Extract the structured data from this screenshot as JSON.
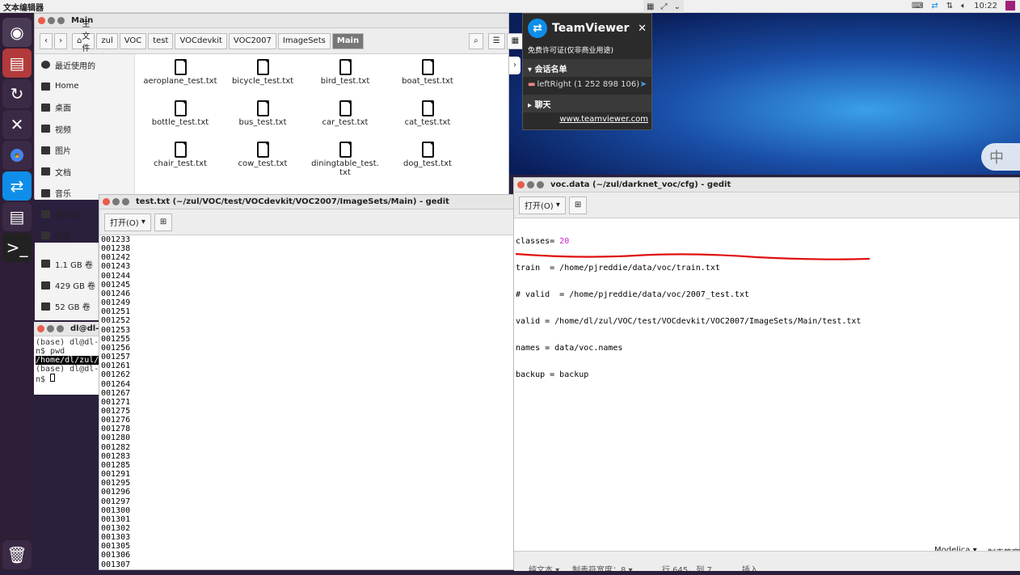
{
  "topbar": {
    "app_name": "文本编辑器",
    "time": "10:22"
  },
  "files_window": {
    "title": "Main",
    "path": [
      "主文件夹",
      "zul",
      "VOC",
      "test",
      "VOCdevkit",
      "VOC2007",
      "ImageSets",
      "Main"
    ],
    "sidebar": [
      "最近使用的",
      "Home",
      "桌面",
      "视频",
      "图片",
      "文档",
      "音乐",
      "回收站",
      "网络",
      "1.1 GB 卷",
      "429 GB 卷",
      "52 GB 卷"
    ],
    "files": [
      "aeroplane_test.txt",
      "bicycle_test.txt",
      "bird_test.txt",
      "boat_test.txt",
      "bottle_test.txt",
      "bus_test.txt",
      "car_test.txt",
      "cat_test.txt",
      "chair_test.txt",
      "cow_test.txt",
      "diningtable_test.\ntxt",
      "dog_test.txt"
    ]
  },
  "teamviewer": {
    "brand": "TeamViewer",
    "license": "免费许可证(仅非商业用途)",
    "sessions_label": "会话名单",
    "session_item": "leftRight (1 252 898 106)",
    "chat_label": "聊天",
    "link": "www.teamviewer.com"
  },
  "terminal": {
    "title": "dl@dl-",
    "lines": [
      "(base) dl@dl-",
      "n$ pwd",
      "/home/dl/zul/",
      "(base) dl@dl-",
      "n$ "
    ]
  },
  "gedit_test": {
    "title": "test.txt (~/zul/VOC/test/VOCdevkit/VOC2007/ImageSets/Main) - gedit",
    "open_label": "打开(O)",
    "lines": [
      "001233",
      "001238",
      "001242",
      "001243",
      "001244",
      "001245",
      "001246",
      "001249",
      "001251",
      "001252",
      "001253",
      "001255",
      "001256",
      "001257",
      "001261",
      "001262",
      "001264",
      "001267",
      "001271",
      "001275",
      "001276",
      "001278",
      "001280",
      "001282",
      "001283",
      "001285",
      "001291",
      "001295",
      "001296",
      "001297",
      "001300",
      "001301",
      "001302",
      "001303",
      "001305",
      "001306",
      "001307"
    ]
  },
  "gedit_voc": {
    "title": "voc.data (~/zul/darknet_voc/cfg) - gedit",
    "open_label": "打开(O)",
    "lines": [
      {
        "key": "classes= ",
        "value": "20"
      },
      {
        "key": "train  = /home/pjreddie/data/voc/train.txt",
        "value": ""
      },
      {
        "key": "# valid  = /home/pjreddie/data/voc/2007_test.txt",
        "value": ""
      },
      {
        "key": "valid = /home/dl/zul/VOC/test/VOCdevkit/VOC2007/ImageSets/Main/test.txt",
        "value": ""
      },
      {
        "key": "names = data/voc.names",
        "value": ""
      },
      {
        "key": "backup = backup",
        "value": ""
      }
    ],
    "status": {
      "lang": "Modelica ▾",
      "tab": "制表符宽",
      "left": "纯文本 ▾",
      "tabwidth": "制表符宽度：8 ▾",
      "pos": "行 645，列 7",
      "ins": "插入"
    }
  },
  "ime": {
    "label": "中"
  }
}
